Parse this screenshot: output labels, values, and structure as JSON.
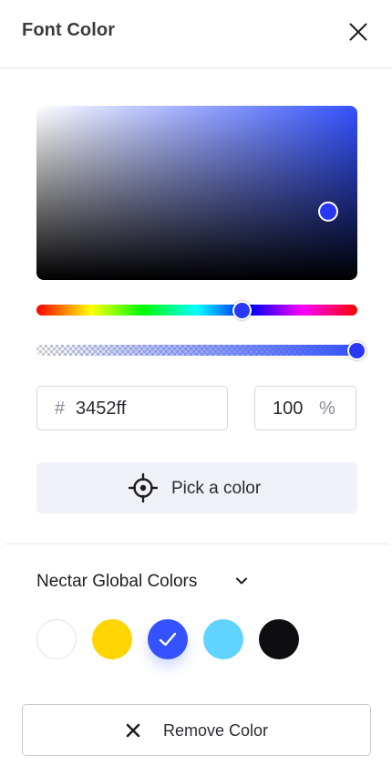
{
  "header": {
    "title": "Font Color"
  },
  "picker": {
    "hex_prefix": "#",
    "hex_value": "3452ff",
    "alpha_value": "100",
    "alpha_unit": "%",
    "selected_color": "#3452ff",
    "alpha_level_percent": 100,
    "pick_label": "Pick a color"
  },
  "palette": {
    "title": "Nectar Global Colors",
    "swatches": [
      {
        "color": "#ffffff",
        "selected": false
      },
      {
        "color": "#ffd500",
        "selected": false
      },
      {
        "color": "#3452ff",
        "selected": true
      },
      {
        "color": "#61d3ff",
        "selected": false
      },
      {
        "color": "#0e0e12",
        "selected": false
      }
    ]
  },
  "actions": {
    "remove_label": "Remove Color"
  },
  "icons": {
    "close": "close-icon",
    "pick": "crosshair-icon",
    "chevron": "chevron-down-icon",
    "check": "checkmark-icon",
    "remove": "x-icon"
  }
}
